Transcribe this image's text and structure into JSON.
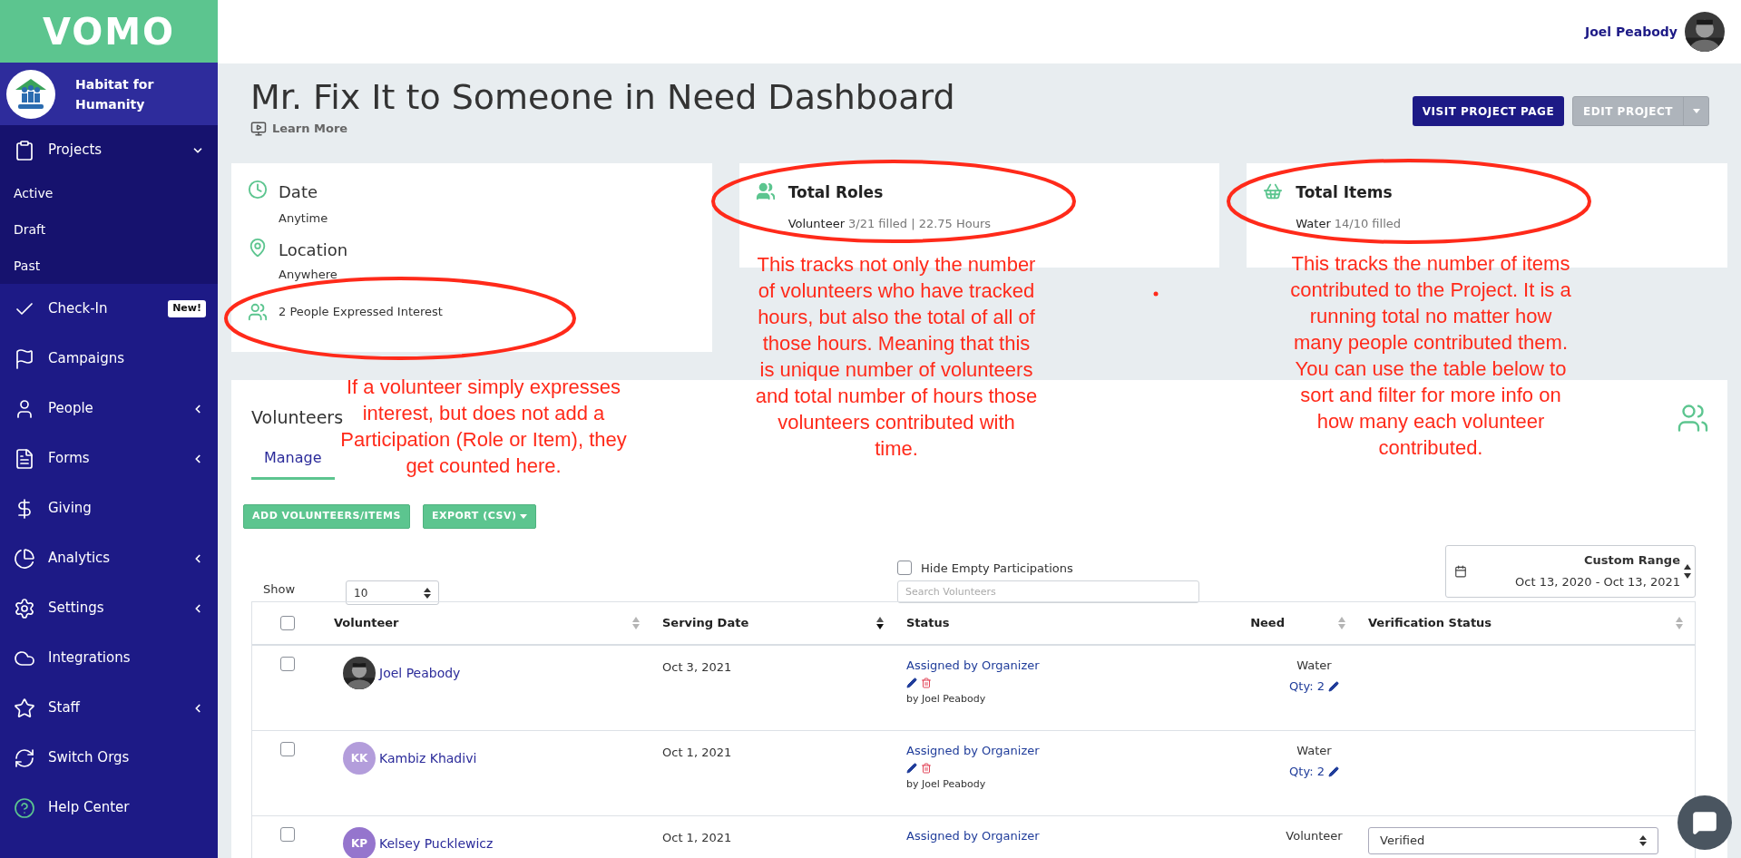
{
  "brand": "VOMO",
  "org": {
    "name": "Habitat for Humanity"
  },
  "sidebar": {
    "items": [
      {
        "label": "Projects",
        "expanded": true,
        "children": [
          {
            "label": "Active"
          },
          {
            "label": "Draft"
          },
          {
            "label": "Past"
          }
        ]
      },
      {
        "label": "Check-In",
        "badge": "New!"
      },
      {
        "label": "Campaigns"
      },
      {
        "label": "People",
        "expanded": false
      },
      {
        "label": "Forms",
        "expanded": false
      },
      {
        "label": "Giving"
      },
      {
        "label": "Analytics",
        "expanded": false
      },
      {
        "label": "Settings",
        "expanded": false
      },
      {
        "label": "Integrations"
      },
      {
        "label": "Staff",
        "expanded": false
      },
      {
        "label": "Switch Orgs"
      },
      {
        "label": "Help Center"
      }
    ]
  },
  "user": {
    "name": "Joel Peabody"
  },
  "page": {
    "title": "Mr. Fix It to Someone in Need Dashboard",
    "learn_more": "Learn More",
    "buttons": [
      {
        "label": "VISIT PROJECT PAGE",
        "disabled": false
      },
      {
        "label": "EDIT PROJECT",
        "disabled": true,
        "dropdown": true
      }
    ]
  },
  "details": {
    "date_label": "Date",
    "date": "Anytime",
    "location_label": "Location",
    "location": "Anywhere",
    "interest": "2 People Expressed Interest"
  },
  "roles": {
    "title": "Total Roles",
    "lines": [
      {
        "name": "Volunteer",
        "detail": "3/21 filled | 22.75 Hours"
      }
    ]
  },
  "items": {
    "title": "Total Items",
    "lines": [
      {
        "name": "Water",
        "detail": "14/10 filled"
      }
    ]
  },
  "volunteers": {
    "title": "Volunteers",
    "tabs": [
      {
        "label": "Manage",
        "selected": true
      }
    ],
    "actions": [
      {
        "label": "ADD VOLUNTEERS/ITEMS",
        "dropdown": false
      },
      {
        "label": "EXPORT (CSV)",
        "dropdown": true
      }
    ],
    "show_label": "Show",
    "page_size": "10",
    "hide_empty": {
      "label": "Hide Empty Participations",
      "checked": false
    },
    "search": {
      "placeholder": "Search Volunteers"
    },
    "range": {
      "label": "Custom Range",
      "value": "Oct 13, 2020 - Oct 13, 2021"
    }
  },
  "table": {
    "select_all": {
      "checked": false
    },
    "columns": [
      {
        "label": "Volunteer",
        "sorted": false
      },
      {
        "label": "Serving Date",
        "sorted": true
      },
      {
        "label": "Status"
      },
      {
        "label": "Need",
        "sorted": false
      },
      {
        "label": "Verification Status",
        "sorted": false
      }
    ],
    "rows": [
      {
        "checked": false,
        "name": "Joel Peabody",
        "date": "Oct 3, 2021",
        "status": "Assigned by Organizer",
        "by": "by Joel Peabody",
        "need": "Water",
        "qty": "Qty: 2"
      },
      {
        "checked": false,
        "avatar": {
          "kind": "initials",
          "initials": "KK",
          "color": "#b39ddb"
        },
        "name": "Kambiz Khadivi",
        "date": "Oct 1, 2021",
        "status": "Assigned by Organizer",
        "by": "by Joel Peabody",
        "need": "Water",
        "qty": "Qty: 2"
      },
      {
        "checked": false,
        "avatar": {
          "kind": "initials",
          "initials": "KP",
          "color": "#9575cd"
        },
        "name": "Kelsey Pucklewicz",
        "date": "Oct 1, 2021",
        "status": "Assigned by Organizer",
        "need": "Volunteer",
        "verification": "Verified"
      }
    ]
  },
  "annotations": [
    {
      "text": "If a volunteer simply expresses interest, but does not add a Participation (Role or Item), they get counted here."
    },
    {
      "text": "This tracks not only the number of volunteers who have tracked hours, but also the total of all of those hours. Meaning that this is unique number of volunteers and total number of hours those volunteers contributed with time."
    },
    {
      "text": "This tracks the number of items contributed to the Project. It is a running total no matter how many people contributed them. You can use the table below to sort and filter for more info on how many each volunteer contributed."
    }
  ]
}
